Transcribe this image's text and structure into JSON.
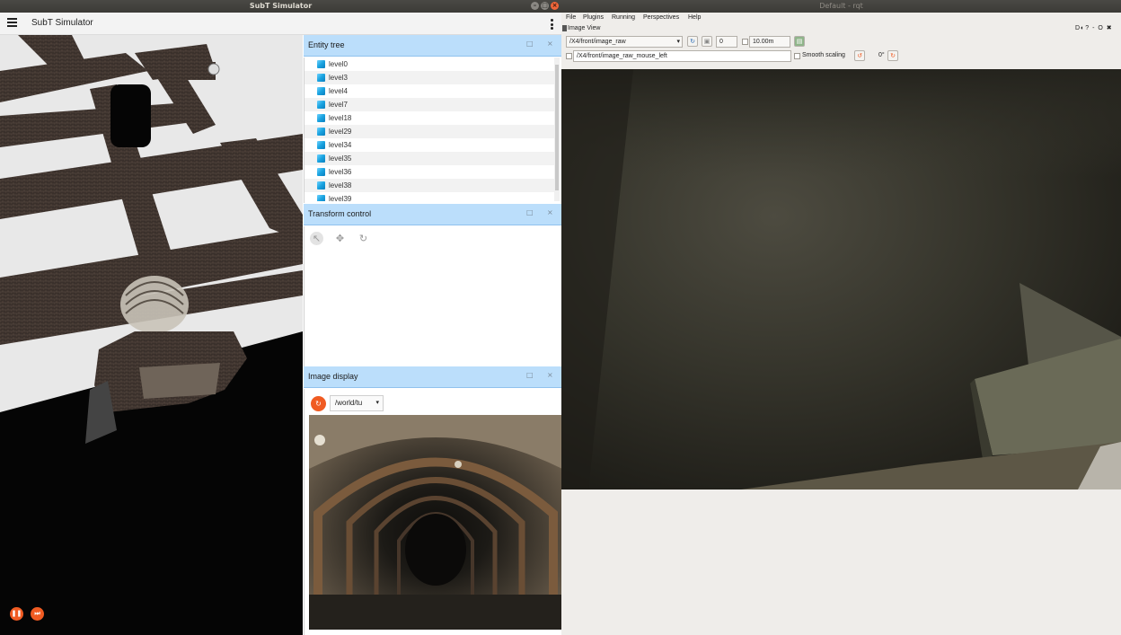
{
  "subt_window": {
    "title": "SubT Simulator",
    "app_title": "SubT Simulator",
    "window_buttons": {
      "minimize": "–",
      "maximize": "□",
      "close": "×"
    }
  },
  "entity_tree": {
    "title": "Entity tree",
    "items": [
      "level0",
      "level3",
      "level4",
      "level7",
      "level18",
      "level29",
      "level34",
      "level35",
      "level36",
      "level38",
      "level39"
    ]
  },
  "transform_control": {
    "title": "Transform control",
    "tools": [
      {
        "icon": "select-icon",
        "glyph": "↖"
      },
      {
        "icon": "translate-icon",
        "glyph": "✥"
      },
      {
        "icon": "rotate-icon",
        "glyph": "↻"
      }
    ]
  },
  "image_display": {
    "title": "Image display",
    "topic": "/world/tu",
    "refresh_glyph": "↻"
  },
  "panel_buttons": {
    "float": "□",
    "close": "×"
  },
  "playback": {
    "pause_glyph": "❚❚",
    "step_glyph": "⏭"
  },
  "rqt_window": {
    "title": "Default - rqt",
    "menu": [
      "File",
      "Plugins",
      "Running",
      "Perspectives",
      "Help"
    ],
    "plugin_title": "Image View",
    "corner_controls": "D◐? - O ✖",
    "topic": "/X4/front/image_raw",
    "number_value": "0",
    "max_range": "10.00m",
    "mouse_topic": "/X4/front/image_raw_mouse_left",
    "smooth_scaling_label": "Smooth scaling",
    "rotation_label": "0°"
  },
  "colors": {
    "accent": "#f05b22",
    "panel_header": "#bbdefb",
    "rqt_background": "#efedea"
  }
}
